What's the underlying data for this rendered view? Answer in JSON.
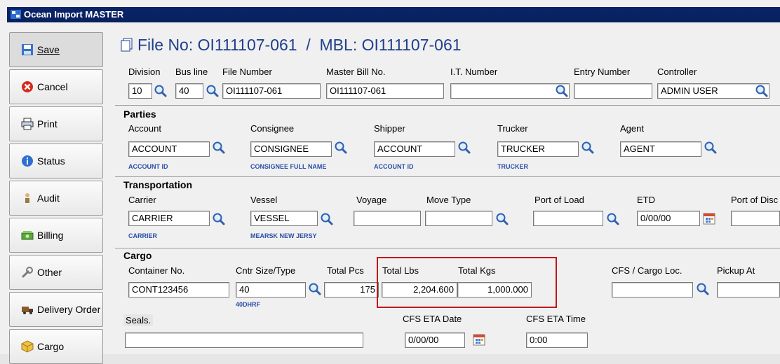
{
  "window": {
    "title": "Ocean Import MASTER"
  },
  "header": {
    "title": "File No: OI111107-061  /  MBL: OI111107-061"
  },
  "sidebar": {
    "items": [
      {
        "label": "Save"
      },
      {
        "label": "Cancel"
      },
      {
        "label": "Print"
      },
      {
        "label": "Status"
      },
      {
        "label": "Audit"
      },
      {
        "label": "Billing"
      },
      {
        "label": "Other"
      },
      {
        "label": "Delivery Order"
      },
      {
        "label": "Cargo"
      }
    ]
  },
  "top": {
    "division": {
      "label": "Division",
      "value": "10"
    },
    "bus_line": {
      "label": "Bus line",
      "value": "40"
    },
    "file_number": {
      "label": "File Number",
      "value": "OI111107-061"
    },
    "master_bill": {
      "label": "Master Bill No.",
      "value": "OI111107-061"
    },
    "it_number": {
      "label": "I.T. Number",
      "value": ""
    },
    "entry_number": {
      "label": "Entry Number",
      "value": ""
    },
    "controller": {
      "label": "Controller",
      "value": "ADMIN USER"
    }
  },
  "parties": {
    "title": "Parties",
    "account": {
      "label": "Account",
      "value": "ACCOUNT",
      "sub": "ACCOUNT ID"
    },
    "consignee": {
      "label": "Consignee",
      "value": "CONSIGNEE",
      "sub": "CONSIGNEE FULL NAME"
    },
    "shipper": {
      "label": "Shipper",
      "value": "ACCOUNT",
      "sub": "ACCOUNT ID"
    },
    "trucker": {
      "label": "Trucker",
      "value": "TRUCKER",
      "sub": "TRUCKER"
    },
    "agent": {
      "label": "Agent",
      "value": "AGENT"
    }
  },
  "transportation": {
    "title": "Transportation",
    "carrier": {
      "label": "Carrier",
      "value": "CARRIER",
      "sub": "CARRIER"
    },
    "vessel": {
      "label": "Vessel",
      "value": "VESSEL",
      "sub": "MEARSK NEW JERSY"
    },
    "voyage": {
      "label": "Voyage",
      "value": ""
    },
    "move_type": {
      "label": "Move Type",
      "value": ""
    },
    "port_of_load": {
      "label": "Port of Load",
      "value": ""
    },
    "etd": {
      "label": "ETD",
      "value": "0/00/00"
    },
    "port_of_discharge": {
      "label": "Port of Disc",
      "value": ""
    }
  },
  "cargo": {
    "title": "Cargo",
    "container_no": {
      "label": "Container No.",
      "value": "CONT123456"
    },
    "cntr_size_type": {
      "label": "Cntr Size/Type",
      "value": "40",
      "sub": "40DHRF"
    },
    "total_pcs": {
      "label": "Total Pcs",
      "value": "175"
    },
    "total_lbs": {
      "label": "Total Lbs",
      "value": "2,204.600"
    },
    "total_kgs": {
      "label": "Total Kgs",
      "value": "1,000.000"
    },
    "cfs_cargo_loc": {
      "label": "CFS / Cargo Loc.",
      "value": ""
    },
    "pickup_at": {
      "label": "Pickup At",
      "value": ""
    },
    "seals": {
      "label": "Seals.",
      "value": ""
    },
    "cfs_eta_date": {
      "label": "CFS ETA Date",
      "value": "0/00/00"
    },
    "cfs_eta_time": {
      "label": "CFS ETA Time",
      "value": "0:00"
    }
  },
  "colors": {
    "title_bar": "#0a246a",
    "heading": "#1f3f8c",
    "highlight": "#c0161b",
    "sublabel": "#2a4fa8"
  }
}
